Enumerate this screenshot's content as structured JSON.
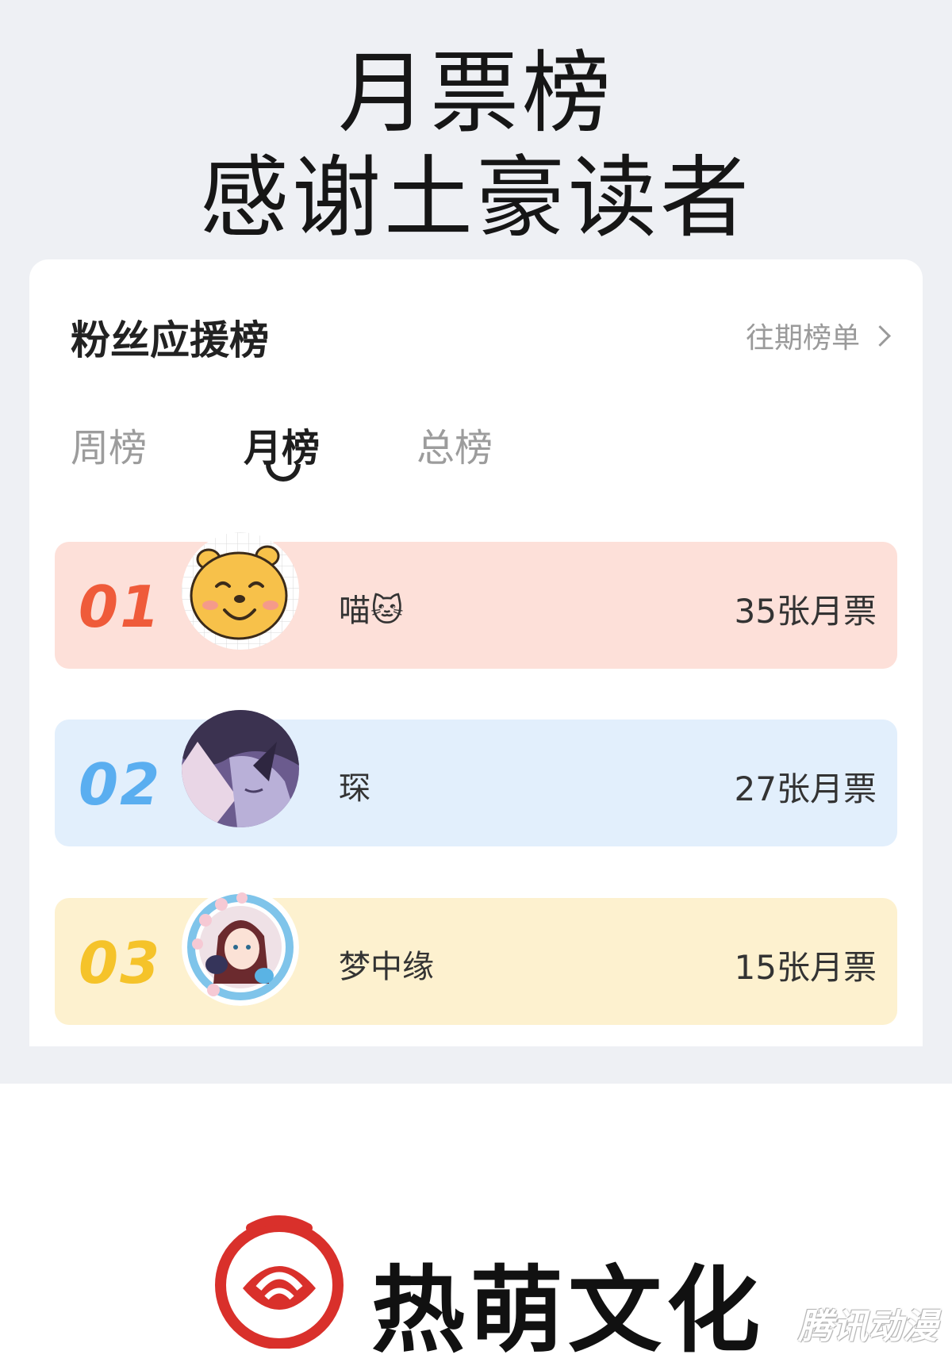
{
  "header": {
    "title_line1": "月票榜",
    "title_line2": "感谢土豪读者"
  },
  "card": {
    "title": "粉丝应援榜",
    "history_link": "往期榜单"
  },
  "tabs": [
    {
      "label": "周榜",
      "active": false
    },
    {
      "label": "月榜",
      "active": true
    },
    {
      "label": "总榜",
      "active": false
    }
  ],
  "ranking": [
    {
      "rank": "01",
      "name": "喵🐱",
      "votes": "35张月票",
      "avatar_icon": "winnie-pooh-avatar-icon"
    },
    {
      "rank": "02",
      "name": "琛",
      "votes": "27张月票",
      "avatar_icon": "anime-boy-avatar-icon"
    },
    {
      "rank": "03",
      "name": "梦中缘",
      "votes": "15张月票",
      "avatar_icon": "anime-girl-flower-avatar-icon"
    }
  ],
  "brand": {
    "name": "热萌文化",
    "logo_color": "#d9302b",
    "watermark": "腾讯动漫"
  },
  "colors": {
    "rank1_bg": "#fde0d9",
    "rank2_bg": "#e2effc",
    "rank3_bg": "#fdf1cf",
    "rank1_num": "#ef5b3a",
    "rank2_num": "#5aaef0",
    "rank3_num": "#f5c32a"
  }
}
